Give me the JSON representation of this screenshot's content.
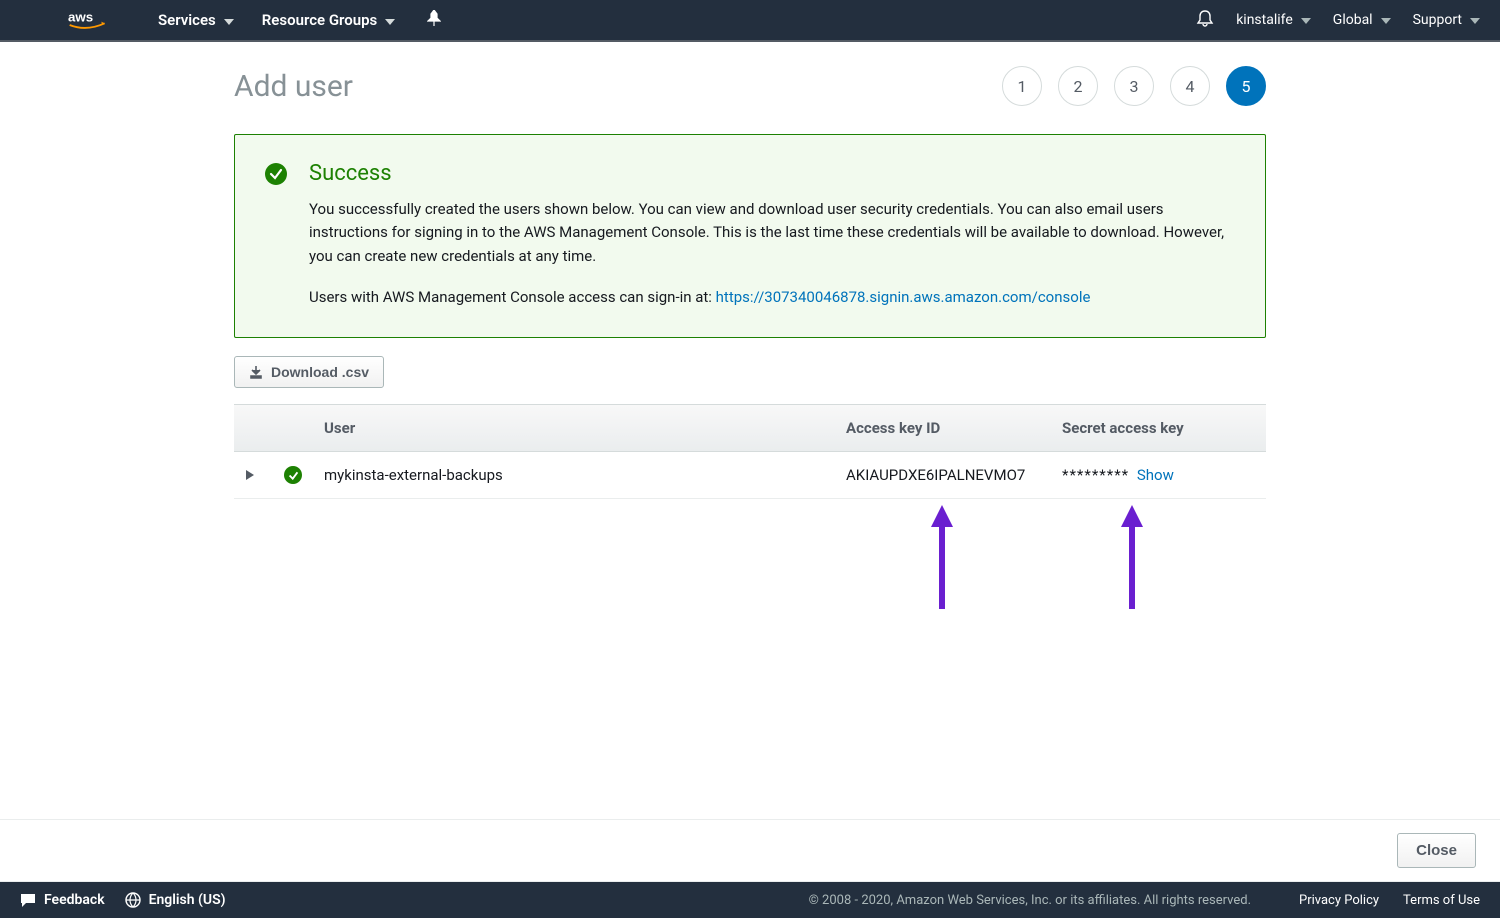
{
  "topnav": {
    "services": "Services",
    "resource_groups": "Resource Groups",
    "account": "kinstalife",
    "region": "Global",
    "support": "Support"
  },
  "page": {
    "title": "Add user"
  },
  "wizard": {
    "steps": [
      "1",
      "2",
      "3",
      "4",
      "5"
    ],
    "current": "5"
  },
  "success": {
    "title": "Success",
    "body1": "You successfully created the users shown below. You can view and download user security credentials. You can also email users instructions for signing in to the AWS Management Console. This is the last time these credentials will be available to download. However, you can create new credentials at any time.",
    "body2_prefix": "Users with AWS Management Console access can sign-in at: ",
    "signin_url": "https://307340046878.signin.aws.amazon.com/console"
  },
  "download_button": "Download .csv",
  "table": {
    "headers": {
      "user": "User",
      "access_key": "Access key ID",
      "secret": "Secret access key"
    },
    "rows": [
      {
        "user": "mykinsta-external-backups",
        "access_key_id": "AKIAUPDXE6IPALNEVMO7",
        "secret_masked": "*********",
        "show_label": "Show"
      }
    ]
  },
  "actions": {
    "close": "Close"
  },
  "footer": {
    "feedback": "Feedback",
    "language": "English (US)",
    "copyright": "© 2008 - 2020, Amazon Web Services, Inc. or its affiliates. All rights reserved.",
    "privacy": "Privacy Policy",
    "terms": "Terms of Use"
  }
}
